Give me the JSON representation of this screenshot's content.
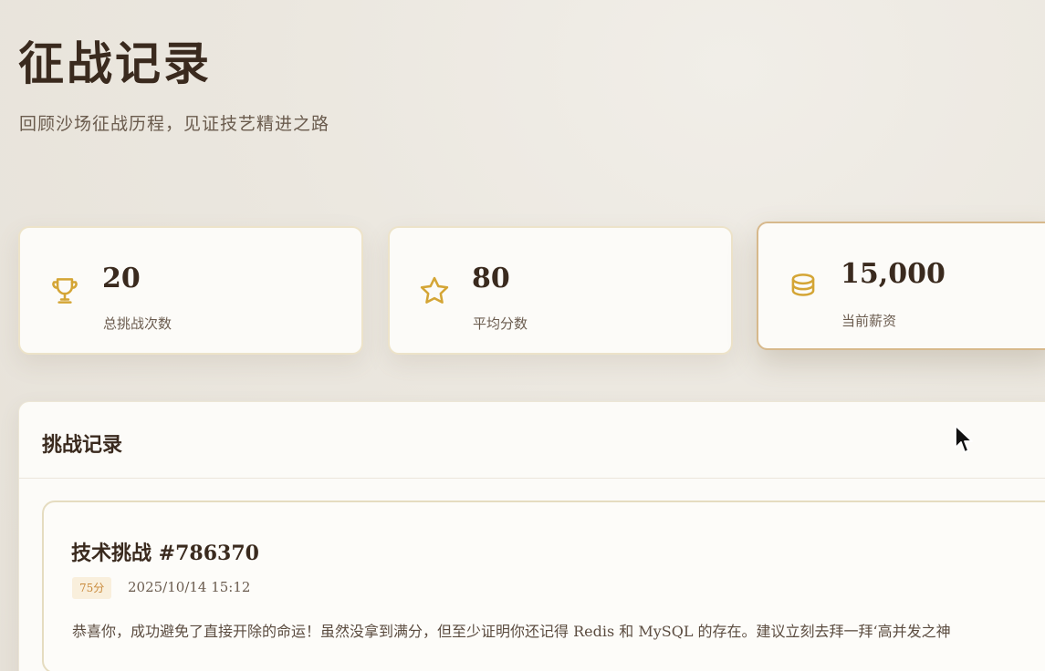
{
  "header": {
    "title": "征战记录",
    "subtitle": "回顾沙场征战历程，见证技艺精进之路"
  },
  "stats": [
    {
      "icon": "trophy-icon",
      "value": "20",
      "label": "总挑战次数"
    },
    {
      "icon": "star-icon",
      "value": "80",
      "label": "平均分数"
    },
    {
      "icon": "coins-icon",
      "value": "15,000",
      "label": "当前薪资"
    }
  ],
  "records": {
    "title": "挑战记录",
    "items": [
      {
        "title": "技术挑战 #786370",
        "score": "75分",
        "date": "2025/10/14 15:12",
        "description": "恭喜你，成功避免了直接开除的命运！虽然没拿到满分，但至少证明你还记得 Redis 和 MySQL 的存在。建议立刻去拜一拜‘高并发之神"
      }
    ]
  },
  "colors": {
    "accent_gold": "#d4a535",
    "text_dark": "#3a2a1e",
    "badge_text": "#c98a3b",
    "badge_bg": "#f9efdc"
  }
}
